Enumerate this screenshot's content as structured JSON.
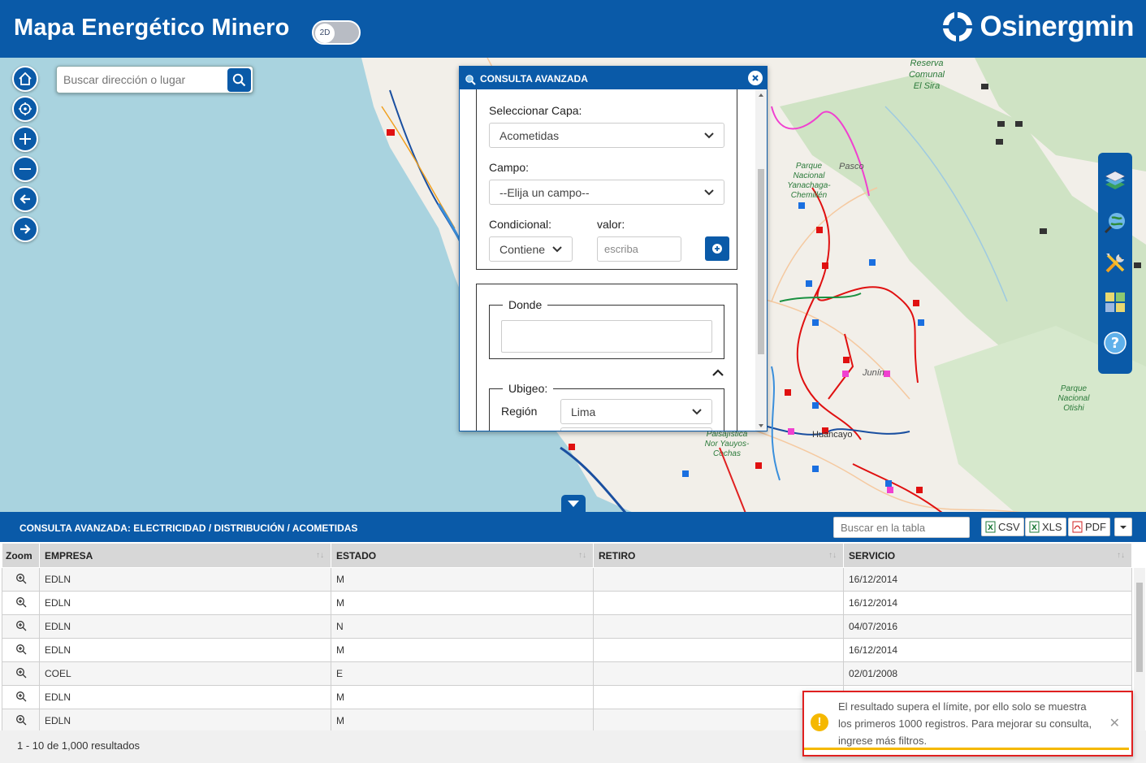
{
  "header": {
    "title": "Mapa Energético Minero",
    "view_toggle": "2D",
    "brand": "Osinergmin"
  },
  "map": {
    "search_placeholder": "Buscar dirección o lugar",
    "labels": [
      {
        "name": "map-label-reserva",
        "text": "Reserva Comunal El Sira"
      },
      {
        "name": "map-label-yanachaga",
        "text": "Parque Nacional Yanachaga-Chemillén"
      },
      {
        "name": "map-label-pasco",
        "text": "Pasco"
      },
      {
        "name": "map-label-junin",
        "text": "Junín"
      },
      {
        "name": "map-label-huancayo",
        "text": "Huancayo"
      },
      {
        "name": "map-label-nor-yauyos",
        "text": "Paisajística Nor Yauyos-Cochas"
      },
      {
        "name": "map-label-otishi",
        "text": "Parque Nacional Otishi"
      }
    ]
  },
  "dialog": {
    "title": "CONSULTA AVANZADA",
    "layer_label": "Seleccionar Capa:",
    "layer_value": "Acometidas",
    "field_label": "Campo:",
    "field_value": "--Elija un campo--",
    "condition_label": "Condicional:",
    "condition_value": "Contiene",
    "value_label": "valor:",
    "value_placeholder": "escriba",
    "where_legend": "Donde",
    "ubigeo_legend": "Ubigeo:",
    "region_label": "Región",
    "region_value": "Lima"
  },
  "results": {
    "title": "CONSULTA AVANZADA: ELECTRICIDAD / DISTRIBUCIÓN / ACOMETIDAS",
    "search_placeholder": "Buscar en la tabla",
    "export_csv": "CSV",
    "export_xls": "XLS",
    "export_pdf": "PDF",
    "columns": [
      "Zoom",
      "EMPRESA",
      "ESTADO",
      "RETIRO",
      "SERVICIO"
    ],
    "rows": [
      {
        "empresa": "EDLN",
        "estado": "M",
        "retiro": "",
        "servicio": "16/12/2014"
      },
      {
        "empresa": "EDLN",
        "estado": "M",
        "retiro": "",
        "servicio": "16/12/2014"
      },
      {
        "empresa": "EDLN",
        "estado": "N",
        "retiro": "",
        "servicio": "04/07/2016"
      },
      {
        "empresa": "EDLN",
        "estado": "M",
        "retiro": "",
        "servicio": "16/12/2014"
      },
      {
        "empresa": "COEL",
        "estado": "E",
        "retiro": "",
        "servicio": "02/01/2008"
      },
      {
        "empresa": "EDLN",
        "estado": "M",
        "retiro": "",
        "servicio": ""
      },
      {
        "empresa": "EDLN",
        "estado": "M",
        "retiro": "",
        "servicio": ""
      }
    ],
    "footer": "1 - 10 de 1,000 resultados"
  },
  "toast": {
    "message": "El resultado supera el límite, por ello solo se muestra los primeros 1000 registros. Para mejorar su consulta, ingrese más filtros."
  },
  "colors": {
    "primary": "#0a5aa8",
    "sea": "#a9d3df",
    "land": "#f2efe9",
    "warning": "#f5b800",
    "annotation": "#e02020"
  }
}
